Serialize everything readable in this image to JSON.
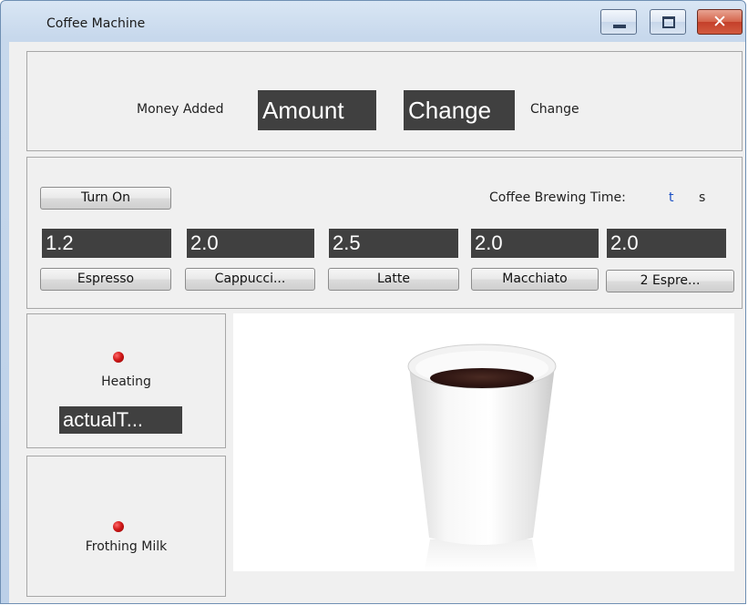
{
  "window": {
    "title": "Coffee Machine"
  },
  "money": {
    "money_added_label": "Money Added",
    "amount_display": "Amount",
    "change_display": "Change",
    "change_label": "Change"
  },
  "controls": {
    "turn_on_label": "Turn On",
    "brewing_time_label": "Coffee Brewing Time:",
    "brewing_time_value": "t",
    "brewing_time_unit": "s"
  },
  "drinks": [
    {
      "price": "1.2",
      "label": "Espresso"
    },
    {
      "price": "2.0",
      "label": "Cappucci..."
    },
    {
      "price": "2.5",
      "label": "Latte"
    },
    {
      "price": "2.0",
      "label": "Macchiato"
    },
    {
      "price": "2.0",
      "label": "2 Espre..."
    }
  ],
  "heating": {
    "label": "Heating",
    "temperature_display": "actualT..."
  },
  "frothing": {
    "label": "Frothing Milk"
  },
  "colors": {
    "lcd_background": "#404040",
    "led_red": "#d11a1a",
    "brewing_time_value": "#1a4fc4"
  },
  "icons": {
    "minimize": "minimize-icon",
    "maximize": "maximize-icon",
    "close": "close-icon",
    "cup": "coffee-cup-icon"
  }
}
